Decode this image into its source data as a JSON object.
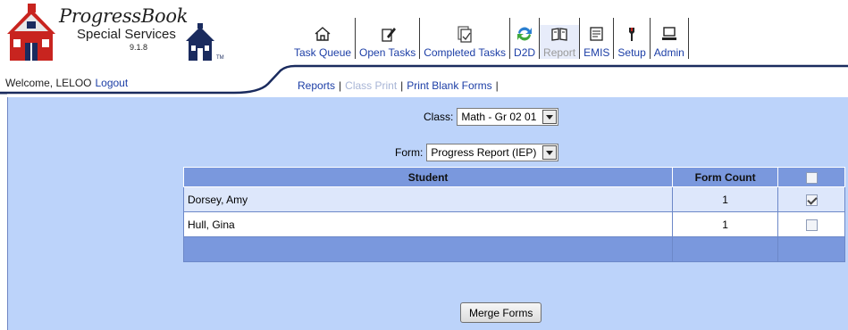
{
  "branding": {
    "title": "ProgressBook",
    "subtitle": "Special Services",
    "version": "9.1.8",
    "tm": "TM"
  },
  "user": {
    "welcome": "Welcome, LELOO",
    "logout": "Logout"
  },
  "nav": [
    {
      "label": "Task Queue",
      "icon": "house-icon",
      "disabled": false
    },
    {
      "label": "Open Tasks",
      "icon": "edit-document-icon",
      "disabled": false
    },
    {
      "label": "Completed Tasks",
      "icon": "completed-document-icon",
      "disabled": false
    },
    {
      "label": "D2D",
      "icon": "sync-arrows-icon",
      "disabled": false
    },
    {
      "label": "Report",
      "icon": "report-book-icon",
      "disabled": true
    },
    {
      "label": "EMIS",
      "icon": "emis-document-icon",
      "disabled": false
    },
    {
      "label": "Setup",
      "icon": "wrench-icon",
      "disabled": false
    },
    {
      "label": "Admin",
      "icon": "computer-icon",
      "disabled": false
    }
  ],
  "subnav": {
    "reports": "Reports",
    "class_print": "Class Print",
    "print_blank_forms": "Print Blank Forms"
  },
  "filters": {
    "class_label": "Class:",
    "class_value": "Math - Gr 02 01",
    "form_label": "Form:",
    "form_value": "Progress Report (IEP)"
  },
  "table": {
    "headers": {
      "student": "Student",
      "form_count": "Form Count"
    },
    "rows": [
      {
        "student": "Dorsey, Amy",
        "form_count": "1",
        "checked": true
      },
      {
        "student": "Hull, Gina",
        "form_count": "1",
        "checked": false
      }
    ]
  },
  "actions": {
    "merge_forms": "Merge Forms"
  },
  "colors": {
    "panel_bg": "#bcd3fa",
    "header_row": "#7a98dd",
    "link": "#1c3ea6",
    "logo_red": "#c8241f",
    "logo_navy": "#1a2b5e"
  }
}
